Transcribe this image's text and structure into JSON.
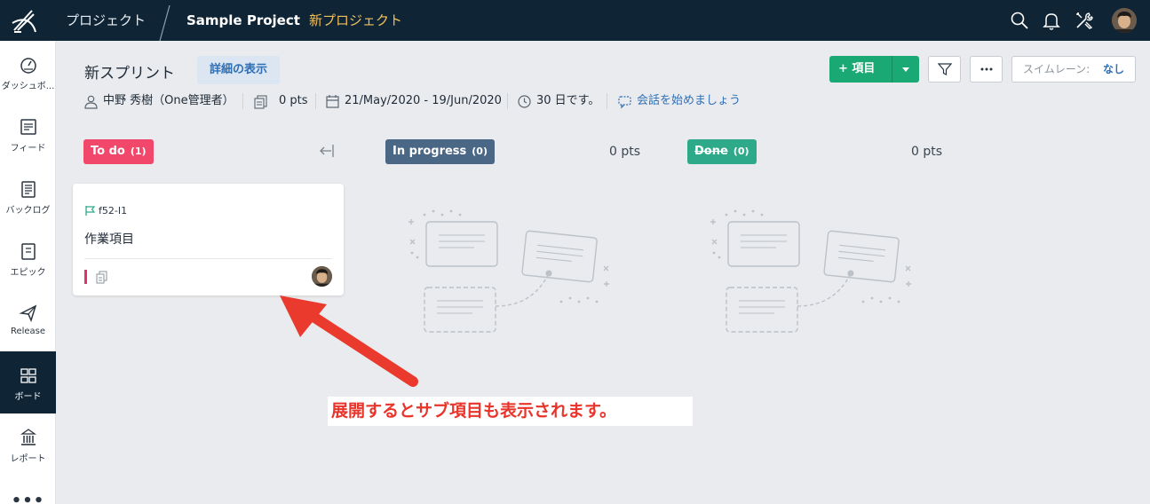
{
  "topbar": {
    "projects_label": "プロジェクト",
    "project_name": "Sample Project",
    "new_project_label": "新プロジェクト",
    "icons": [
      "search-icon",
      "bell-icon",
      "tools-icon"
    ]
  },
  "sidebar": {
    "items": [
      {
        "label": "ダッシュボ...",
        "icon": "dashboard-icon",
        "active": false
      },
      {
        "label": "フィード",
        "icon": "feed-icon",
        "active": false
      },
      {
        "label": "バックログ",
        "icon": "backlog-icon",
        "active": false
      },
      {
        "label": "エピック",
        "icon": "epic-icon",
        "active": false
      },
      {
        "label": "Release",
        "icon": "release-icon",
        "active": false
      },
      {
        "label": "ボード",
        "icon": "board-icon",
        "active": true
      },
      {
        "label": "レポート",
        "icon": "report-icon",
        "active": false
      }
    ],
    "more_label": "•••"
  },
  "header": {
    "sprint_title": "新スプリント",
    "details_button": "詳細の表示",
    "add_button": "項目",
    "swimlane_label": "スイムレーン:",
    "swimlane_value": "なし"
  },
  "meta": {
    "owner": "中野 秀樹（One管理者）",
    "points": "0 pts",
    "date_range": "21/May/2020 - 19/Jun/2020",
    "days_left": "30 日です。",
    "chat_link": "会話を始めましょう"
  },
  "columns": [
    {
      "name": "To do",
      "count": "(1)",
      "points": "",
      "color": "#f0476b"
    },
    {
      "name": "In progress",
      "count": "(0)",
      "points": "0 pts",
      "color": "#4a6785"
    },
    {
      "name": "Done",
      "count": "(0)",
      "points": "0 pts",
      "color": "#2eaa8a"
    }
  ],
  "card": {
    "id": "f52-I1",
    "title": "作業項目",
    "priority_color": "#e0336d"
  },
  "annotation": {
    "text": "展開するとサブ項目も表示されます。",
    "color": "#e8342a"
  }
}
